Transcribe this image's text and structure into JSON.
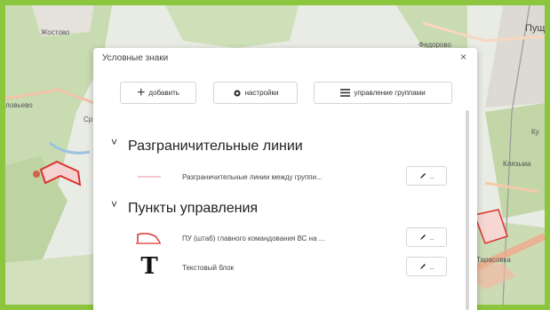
{
  "map": {
    "labels": {
      "zhostovo": "Жостово",
      "pushkino": "Пущ",
      "fyodorovo": "Федорово",
      "left_top": "ловьево",
      "klyazma": "Клязьма",
      "tarasovka": "Тарасовка",
      "ku": "Ку",
      "cp": "Ср"
    },
    "colors": {
      "frame": "#8cc63f",
      "forest": "#c9dbb1",
      "urban": "#dcdad3",
      "road": "#f2c3a8",
      "river": "#9ac4e0",
      "red_zone": "#d9332e"
    }
  },
  "dialog": {
    "title": "Условные знаки",
    "close_icon": "close-icon",
    "toolbar": {
      "add_label": "добавить",
      "settings_label": "настройки",
      "groups_label": "управление группами"
    },
    "groups": [
      {
        "title": "Разграничительные линии",
        "items": [
          {
            "label": "Разграничительные линии между группи...",
            "icon": "pink-line-icon",
            "edit_label": ".."
          }
        ]
      },
      {
        "title": "Пункты управления",
        "items": [
          {
            "label": "ПУ (штаб) главного командования ВС на ...",
            "icon": "red-flag-shape-icon",
            "edit_label": ".."
          },
          {
            "label": "Текстовый блок",
            "icon": "text-block-icon",
            "glyph": "T",
            "edit_label": ".."
          }
        ]
      }
    ]
  }
}
